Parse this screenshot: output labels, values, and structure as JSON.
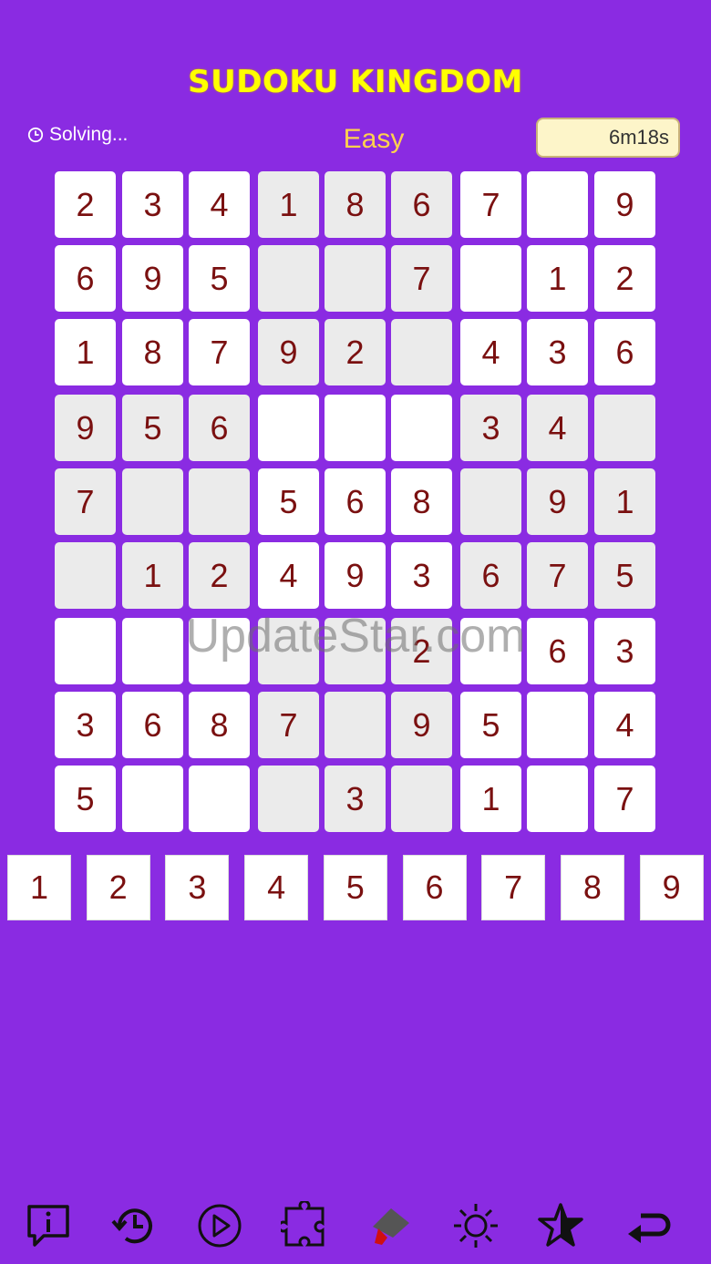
{
  "title": "SUDOKU KINGDOM",
  "status": {
    "text": "Solving..."
  },
  "difficulty": "Easy",
  "timer": "6m18s",
  "watermark": "UpdateStar.com",
  "grid": [
    [
      "2",
      "3",
      "4",
      "1",
      "8",
      "6",
      "7",
      "",
      "9"
    ],
    [
      "6",
      "9",
      "5",
      "",
      "",
      "7",
      "",
      "1",
      "2"
    ],
    [
      "1",
      "8",
      "7",
      "9",
      "2",
      "",
      "4",
      "3",
      "6"
    ],
    [
      "9",
      "5",
      "6",
      "",
      "",
      "",
      "3",
      "4",
      ""
    ],
    [
      "7",
      "",
      "",
      "5",
      "6",
      "8",
      "",
      "9",
      "1"
    ],
    [
      "",
      "1",
      "2",
      "4",
      "9",
      "3",
      "6",
      "7",
      "5"
    ],
    [
      "",
      "",
      "",
      "",
      "",
      "2",
      "",
      "6",
      "3"
    ],
    [
      "3",
      "6",
      "8",
      "7",
      "",
      "9",
      "5",
      "",
      "4"
    ],
    [
      "5",
      "",
      "",
      "",
      "3",
      "",
      "1",
      "",
      "7"
    ]
  ],
  "keypad": [
    "1",
    "2",
    "3",
    "4",
    "5",
    "6",
    "7",
    "8",
    "9"
  ],
  "toolbar": [
    {
      "icon": "info-icon"
    },
    {
      "icon": "history-icon"
    },
    {
      "icon": "play-icon"
    },
    {
      "icon": "puzzle-icon"
    },
    {
      "icon": "brush-icon"
    },
    {
      "icon": "brightness-icon"
    },
    {
      "icon": "star-icon"
    },
    {
      "icon": "back-arrow-icon"
    }
  ],
  "colors": {
    "background": "#8a2be2",
    "title": "#ffff00",
    "difficulty": "#ffd24d",
    "digit": "#7a1010"
  }
}
